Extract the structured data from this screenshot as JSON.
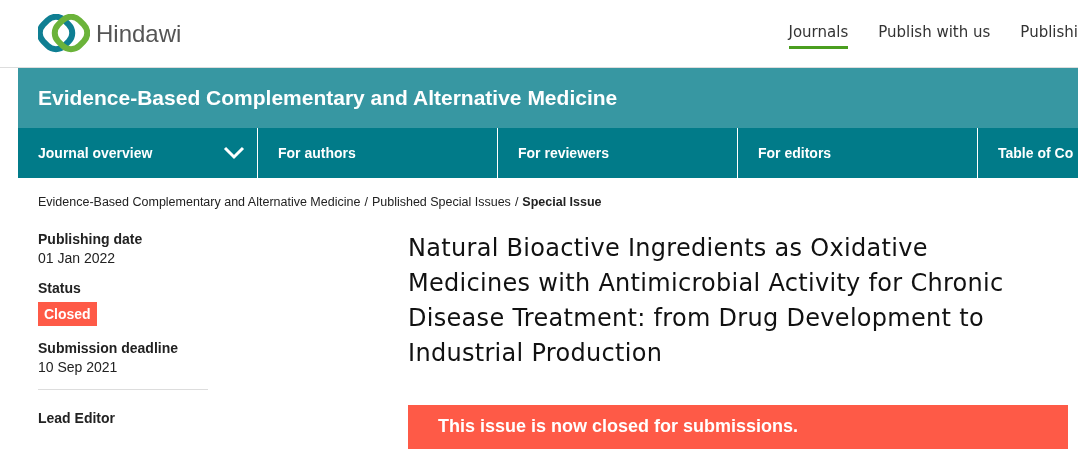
{
  "header": {
    "brand": "Hindawi",
    "nav": [
      {
        "label": "Journals",
        "selected": true
      },
      {
        "label": "Publish with us",
        "selected": false
      },
      {
        "label": "Publishi",
        "selected": false
      }
    ]
  },
  "journal": {
    "title": "Evidence-Based Complementary and Alternative Medicine"
  },
  "tabs": [
    {
      "label": "Journal overview",
      "expanded": false
    },
    {
      "label": "For authors"
    },
    {
      "label": "For reviewers"
    },
    {
      "label": "For editors"
    },
    {
      "label": "Table of Co"
    }
  ],
  "breadcrumb": [
    {
      "label": "Evidence-Based Complementary and Alternative Medicine",
      "current": false
    },
    {
      "label": "Published Special Issues",
      "current": false,
      "separator": "/"
    },
    {
      "label": "Special Issue",
      "current": true,
      "separator": "/"
    }
  ],
  "sidebar": {
    "fields": [
      {
        "kind": "text",
        "label": "Publishing date",
        "value": "01 Jan 2022"
      },
      {
        "kind": "badge",
        "label": "Status",
        "value": "Closed"
      },
      {
        "kind": "text",
        "label": "Submission deadline",
        "value": "10 Sep 2021"
      }
    ],
    "lead_editor": {
      "label": "Lead Editor"
    }
  },
  "issue": {
    "title": "Natural Bioactive Ingredients as Oxidative Medicines with Antimicrobial Activity for Chronic Disease Treatment: from Drug Development to Industrial Production",
    "notice": "This issue is now closed for submissions."
  }
}
